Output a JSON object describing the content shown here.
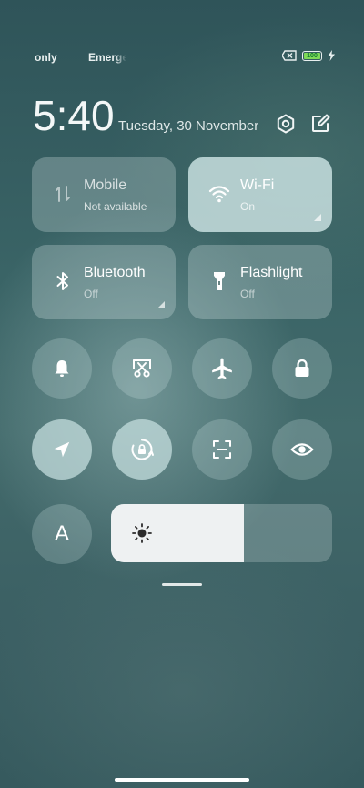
{
  "status": {
    "carrier1": "only",
    "carrier2": "Emergency",
    "battery_level": "100"
  },
  "header": {
    "time": "5:40",
    "date": "Tuesday, 30 November"
  },
  "tiles": [
    {
      "title": "Mobile",
      "subtitle": "Not available",
      "icon": "mobile-data-icon",
      "state": "disabled"
    },
    {
      "title": "Wi-Fi",
      "subtitle": "On",
      "icon": "wifi-icon",
      "state": "on"
    },
    {
      "title": "Bluetooth",
      "subtitle": "Off",
      "icon": "bluetooth-icon",
      "state": "off"
    },
    {
      "title": "Flashlight",
      "subtitle": "Off",
      "icon": "flashlight-icon",
      "state": "off"
    }
  ],
  "toggles_row1": [
    {
      "name": "silent-mode",
      "icon": "bell-icon",
      "active": false
    },
    {
      "name": "screenshot",
      "icon": "scissors-icon",
      "active": false
    },
    {
      "name": "airplane-mode",
      "icon": "airplane-icon",
      "active": false
    },
    {
      "name": "lock-screen",
      "icon": "lock-icon",
      "active": false
    }
  ],
  "toggles_row2": [
    {
      "name": "location",
      "icon": "location-arrow-icon",
      "active": true
    },
    {
      "name": "rotation-lock",
      "icon": "rotation-lock-icon",
      "active": true
    },
    {
      "name": "scanner",
      "icon": "scan-icon",
      "active": false
    },
    {
      "name": "reading-mode",
      "icon": "eye-icon",
      "active": false
    }
  ],
  "auto_brightness_label": "A",
  "brightness": {
    "level": 0.6
  },
  "colors": {
    "background": "#3a6466",
    "tile_active": "#cde4e4",
    "brightness_fill": "#eef1f2",
    "battery": "#7ed957"
  }
}
